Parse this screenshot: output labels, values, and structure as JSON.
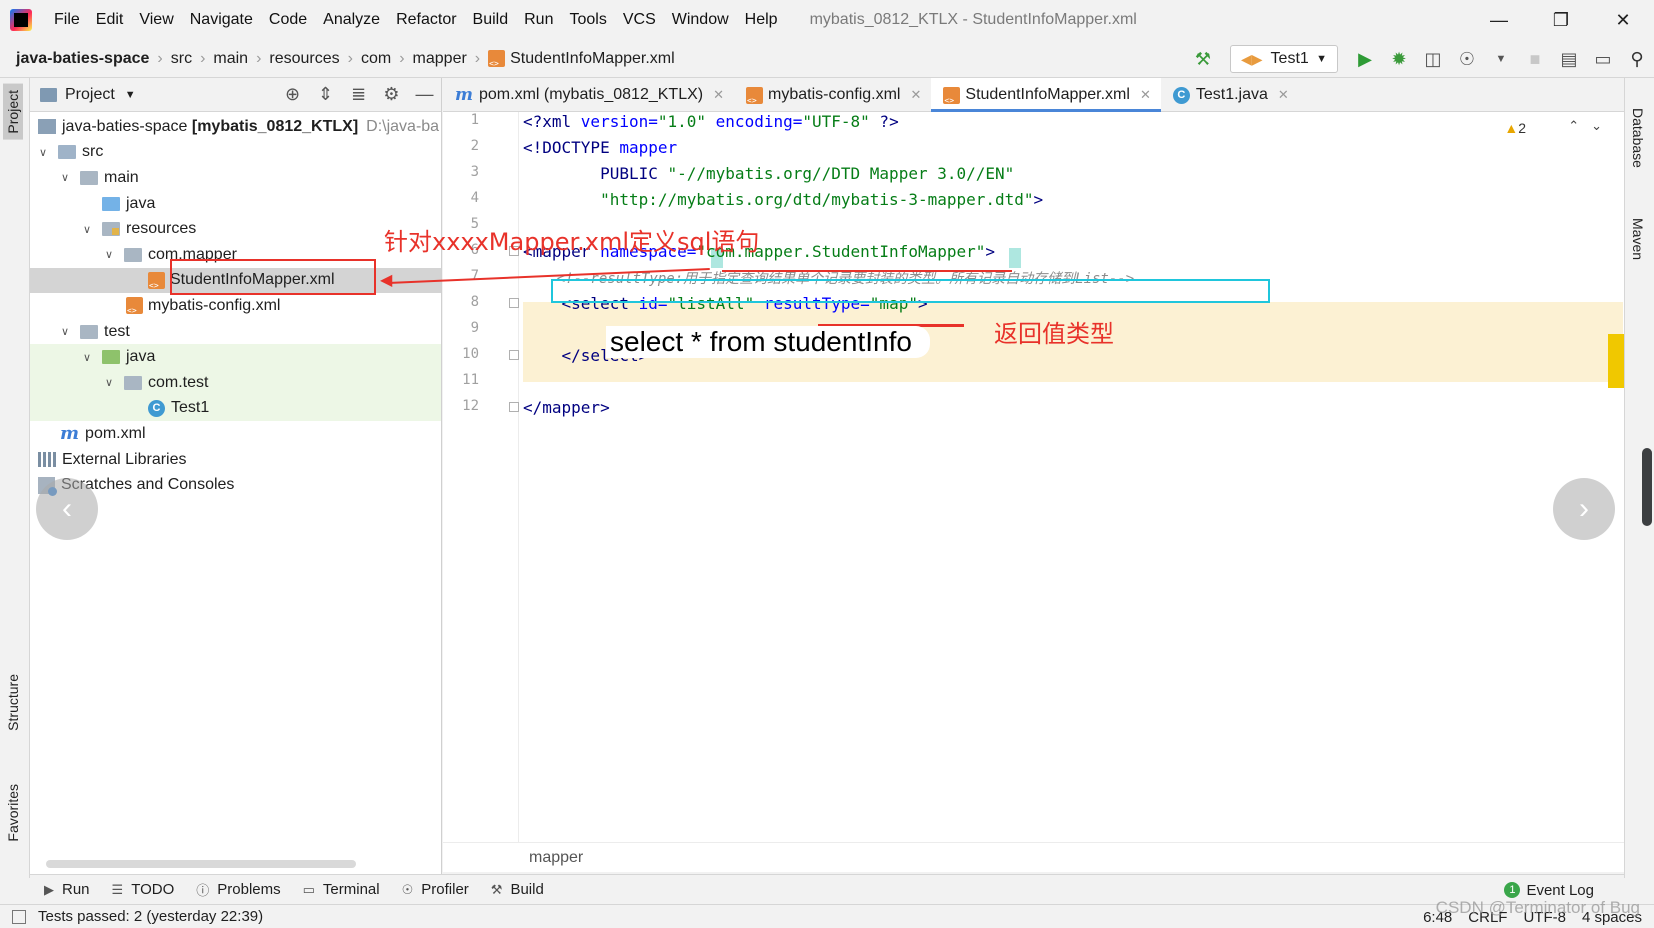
{
  "menu": {
    "items": [
      "File",
      "Edit",
      "View",
      "Navigate",
      "Code",
      "Analyze",
      "Refactor",
      "Build",
      "Run",
      "Tools",
      "VCS",
      "Window",
      "Help"
    ],
    "window_title": "mybatis_0812_KTLX - StudentInfoMapper.xml"
  },
  "navbar": {
    "crumbs": [
      "java-baties-space",
      "src",
      "main",
      "resources",
      "com",
      "mapper",
      "StudentInfoMapper.xml"
    ],
    "run_config": "Test1"
  },
  "stripes": {
    "left": {
      "project": "Project",
      "structure": "Structure",
      "favorites": "Favorites"
    },
    "right": {
      "database": "Database",
      "maven": "Maven"
    }
  },
  "project_panel": {
    "title": "Project",
    "tree": [
      {
        "label": "java-baties-space",
        "bold": "[mybatis_0812_KTLX]",
        "path": "D:\\java-ba"
      },
      {
        "label": "src"
      },
      {
        "label": "main"
      },
      {
        "label": "java"
      },
      {
        "label": "resources"
      },
      {
        "label": "com.mapper"
      },
      {
        "label": "StudentInfoMapper.xml"
      },
      {
        "label": "mybatis-config.xml"
      },
      {
        "label": "test"
      },
      {
        "label": "java"
      },
      {
        "label": "com.test"
      },
      {
        "label": "Test1"
      },
      {
        "label": "pom.xml"
      },
      {
        "label": "External Libraries"
      },
      {
        "label": "Scratches and Consoles"
      }
    ]
  },
  "tabs": [
    {
      "label": "pom.xml (mybatis_0812_KTLX)"
    },
    {
      "label": "mybatis-config.xml"
    },
    {
      "label": "StudentInfoMapper.xml"
    },
    {
      "label": "Test1.java"
    }
  ],
  "editor": {
    "line_numbers": [
      "1",
      "2",
      "3",
      "4",
      "5",
      "6",
      "7",
      "8",
      "9",
      "10",
      "11",
      "12"
    ],
    "code": {
      "l1_a": "<?xml ",
      "l1_b": "version=",
      "l1_c": "\"1.0\"",
      "l1_d": " encoding=",
      "l1_e": "\"UTF-8\"",
      "l1_f": " ?>",
      "l2_a": "<!DOCTYPE ",
      "l2_b": "mapper",
      "l3_a": "        PUBLIC ",
      "l3_b": "\"-//mybatis.org//DTD Mapper 3.0//EN\"",
      "l4_a": "        ",
      "l4_b": "\"http://mybatis.org/dtd/mybatis-3-mapper.dtd\"",
      "l4_c": ">",
      "l6_a": "<mapper ",
      "l6_b": "namespace=",
      "l6_c": "\"com.mapper.StudentInfoMapper\"",
      "l6_d": ">",
      "l7": "    <!--resultType:用于指定查询结果单个记录要封装的类型。所有记录自动存储到List-->",
      "l8_a": "    <select ",
      "l8_b": "id=",
      "l8_c": "\"listAll\"",
      "l8_d": " resultType=",
      "l8_e": "\"map\"",
      "l8_f": ">",
      "l10": "    </select>",
      "l12": "</mapper>"
    },
    "warning_count": "2",
    "bottom_breadcrumb": "mapper"
  },
  "annotations": {
    "define_sql": "针对xxxxMapper.xml定义sql语句",
    "return_type": "返回值类型",
    "sql_overlay": "select * from studentInfo"
  },
  "bottom_bar": {
    "items": [
      "Run",
      "TODO",
      "Problems",
      "Terminal",
      "Profiler",
      "Build"
    ],
    "event_log": "Event Log",
    "event_count": "1"
  },
  "status": {
    "message": "Tests passed: 2 (yesterday 22:39)",
    "position": "6:48",
    "line_sep": "CRLF",
    "encoding": "UTF-8",
    "indent": "4 spaces",
    "watermark": "CSDN @Terminator of Bug"
  },
  "colors": {
    "accent": "#4a86d8",
    "annotation_red": "#e8322a",
    "annotation_cyan": "#1fc6dc",
    "highlight": "#fcf1d3"
  }
}
